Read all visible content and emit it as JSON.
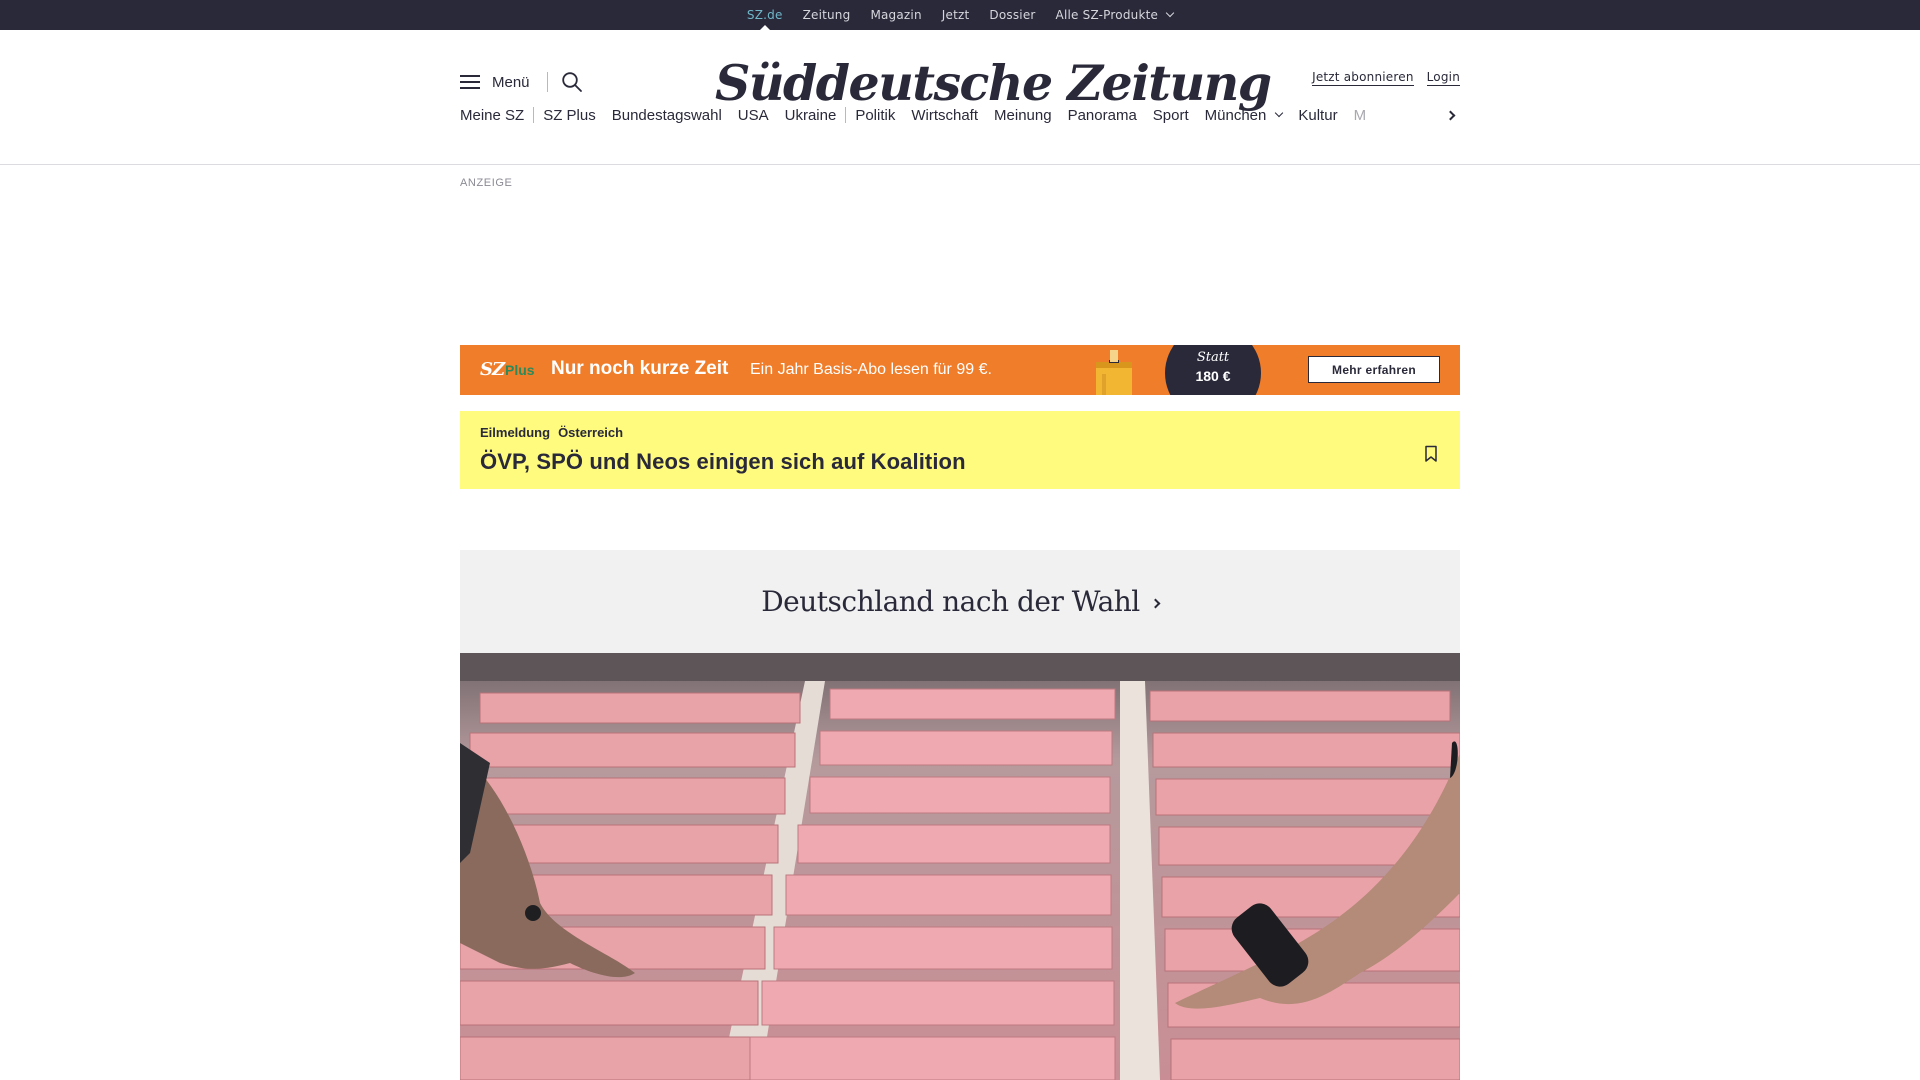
{
  "topbar": {
    "items": [
      {
        "label": "SZ.de",
        "active": true
      },
      {
        "label": "Zeitung",
        "active": false
      },
      {
        "label": "Magazin",
        "active": false
      },
      {
        "label": "Jetzt",
        "active": false
      },
      {
        "label": "Dossier",
        "active": false
      },
      {
        "label": "Alle SZ-Produkte",
        "active": false,
        "icon": "chevron-down-icon"
      }
    ]
  },
  "header": {
    "menu_label": "Menü",
    "logo": "Süddeutsche Zeitung",
    "subscribe_label": "Jetzt abonnieren",
    "login_label": "Login"
  },
  "nav": {
    "items": [
      "Meine SZ",
      "SZ Plus",
      "Bundestagswahl",
      "USA",
      "Ukraine",
      "Politik",
      "Wirtschaft",
      "Meinung",
      "Panorama",
      "Sport",
      "München",
      "Kultur",
      "M"
    ],
    "more_icon": "chevron-right-icon"
  },
  "ad": {
    "label": "ANZEIGE"
  },
  "promo": {
    "brand": "SZ",
    "brand_plus": "Plus",
    "headline": "Nur noch kurze Zeit",
    "sub": "Ein Jahr Basis-Abo lesen für 99 €.",
    "statt": "Statt",
    "price": "180 €",
    "cta": "Mehr erfahren",
    "colors": {
      "background": "#ef7d2a",
      "circle": "#29293a",
      "plus": "#2c8a5a"
    }
  },
  "breaking": {
    "kicker_label": "Eilmeldung",
    "kicker_topic": "Österreich",
    "title": "ÖVP, SPÖ und Neos einigen sich auf Koalition",
    "bookmark_icon": "bookmark-icon",
    "background": "#fefb7f"
  },
  "topic": {
    "title": "Deutschland nach der Wahl",
    "icon": "chevron-right-icon"
  },
  "hero": {
    "description_icon": "photo"
  }
}
